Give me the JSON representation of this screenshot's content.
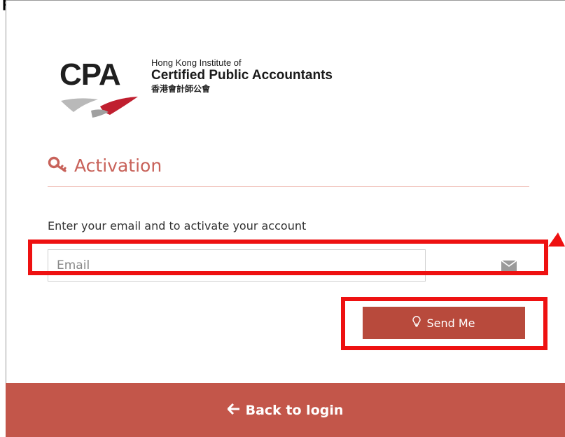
{
  "header": {
    "cut_label": "p"
  },
  "logo": {
    "acronym": "CPA",
    "line1": "Hong Kong Institute of",
    "line2": "Certified Public Accountants",
    "line3": "香港會計師公會"
  },
  "form": {
    "heading": "Activation",
    "instructions": "Enter your email and to activate your account",
    "email": {
      "placeholder": "Email",
      "value": ""
    },
    "submit_label": "Send Me"
  },
  "footer": {
    "back_label": "Back to login"
  },
  "icons": {
    "heading": "key-icon",
    "email": "envelope-icon",
    "submit": "lightbulb-icon",
    "back": "arrow-left-icon"
  },
  "colors": {
    "accent": "#c8625a",
    "button": "#b84a3c",
    "footer": "#c3564a",
    "highlight": "#ee1111"
  }
}
